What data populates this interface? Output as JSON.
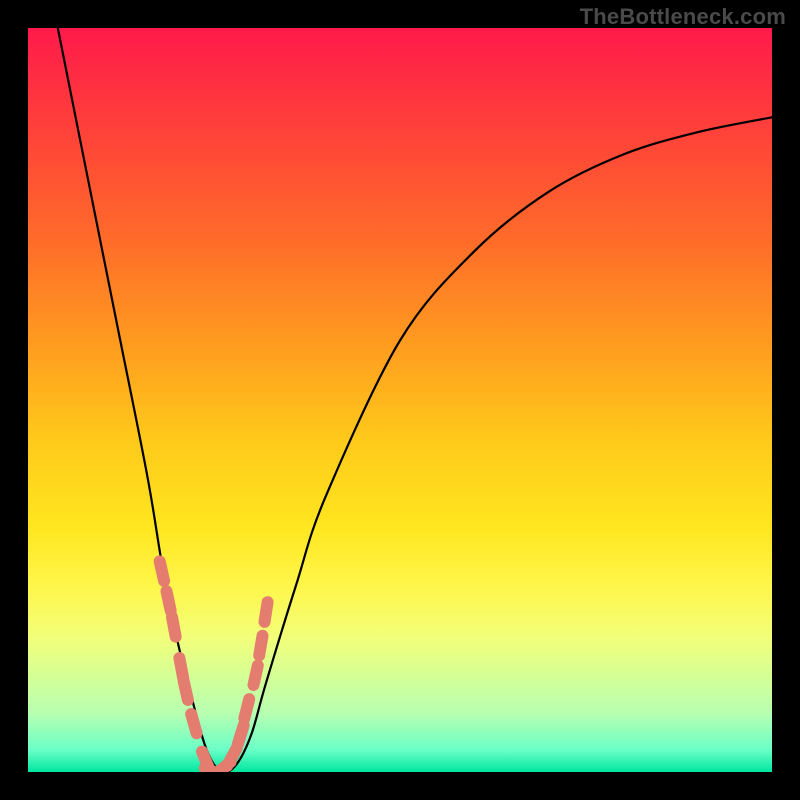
{
  "source_watermark": "TheBottleneck.com",
  "colors": {
    "frame": "#000000",
    "curve": "#000000",
    "marker": "#e47d6f"
  },
  "chart_data": {
    "type": "line",
    "title": "",
    "xlabel": "",
    "ylabel": "",
    "xlim": [
      0,
      100
    ],
    "ylim": [
      0,
      100
    ],
    "grid": false,
    "legend": false,
    "annotations": [
      "TheBottleneck.com"
    ],
    "note": "V-shaped bottleneck curve. x is relative component-balance position (0–100 across the plot width), y is bottleneck percentage (0% at the bottom, 100% at the top). Values are visually estimated from the unlabeled plot; the minimum (≈0%) sits near x≈25.",
    "series": [
      {
        "name": "bottleneck_percent",
        "x": [
          4,
          8,
          12,
          16,
          18,
          20,
          22,
          24,
          26,
          28,
          30,
          32,
          36,
          40,
          50,
          60,
          70,
          80,
          90,
          100
        ],
        "values": [
          100,
          80,
          60,
          40,
          28,
          18,
          10,
          3,
          0,
          1,
          5,
          12,
          25,
          37,
          58,
          70,
          78,
          83,
          86,
          88
        ]
      }
    ],
    "markers": {
      "name": "highlighted_points",
      "x": [
        18.0,
        18.9,
        19.6,
        20.6,
        21.2,
        22.3,
        23.9,
        25.0,
        26.2,
        27.4,
        28.6,
        29.4,
        30.6,
        31.3,
        32.0
      ],
      "values": [
        27.0,
        23.0,
        19.5,
        14.0,
        11.0,
        6.5,
        1.5,
        0.0,
        0.5,
        2.0,
        5.0,
        8.5,
        13.0,
        17.0,
        21.5
      ]
    }
  }
}
